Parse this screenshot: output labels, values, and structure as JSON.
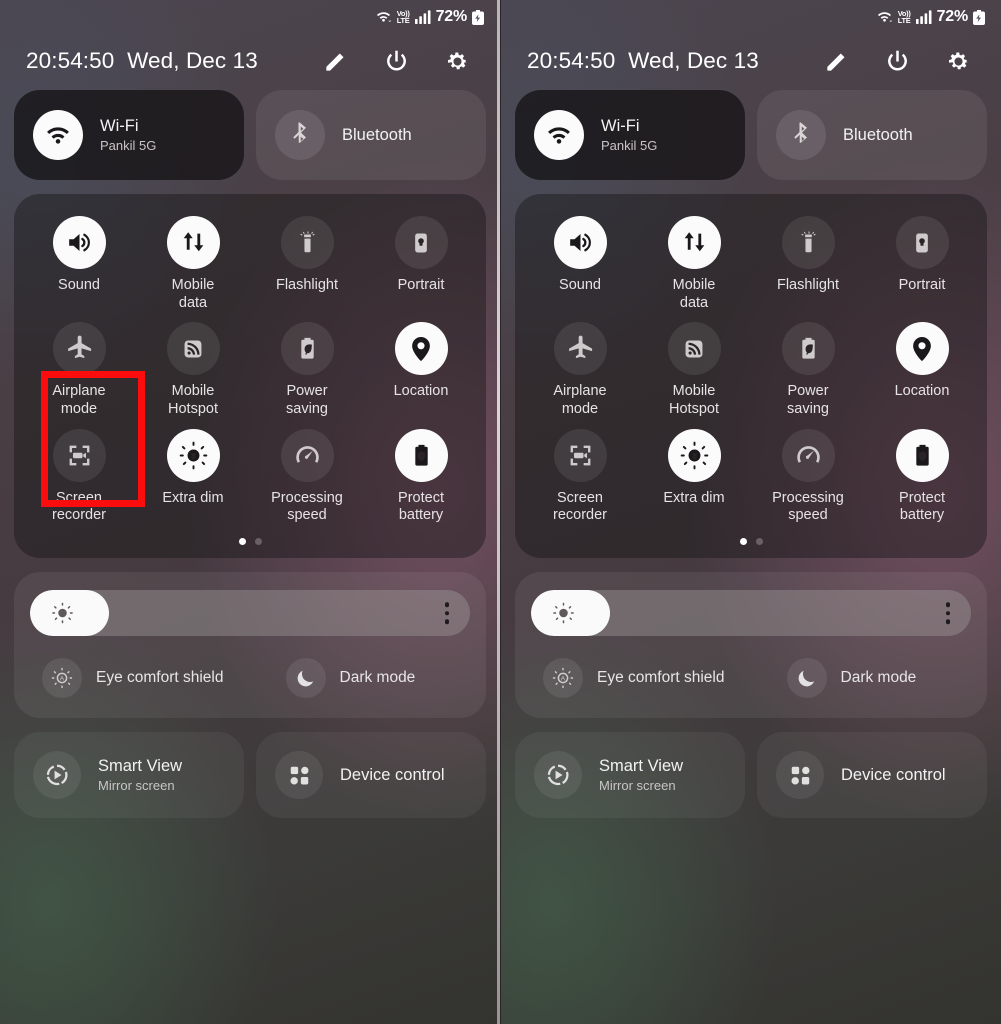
{
  "status_bar": {
    "wifi_icon": "wifi-icon",
    "volte_top": "Vo))",
    "volte_bottom": "LTE",
    "signal_icon": "signal-bars-icon",
    "battery_percent": "72%",
    "battery_icon": "battery-charging-icon"
  },
  "header": {
    "time": "20:54:50",
    "date": "Wed, Dec 13",
    "edit_icon": "pencil-icon",
    "power_icon": "power-icon",
    "settings_icon": "gear-icon"
  },
  "connectivity_tiles": [
    {
      "name": "wifi",
      "icon": "wifi-icon",
      "title": "Wi-Fi",
      "subtitle": "Pankil 5G",
      "active": true
    },
    {
      "name": "bluetooth",
      "icon": "bluetooth-icon",
      "title": "Bluetooth",
      "subtitle": "",
      "active": false
    }
  ],
  "quick_tiles": [
    {
      "name": "sound",
      "icon": "volume-icon",
      "label": "Sound",
      "active": true
    },
    {
      "name": "mobile-data",
      "icon": "data-transfer-icon",
      "label": "Mobile\ndata",
      "active": true
    },
    {
      "name": "flashlight",
      "icon": "flashlight-icon",
      "label": "Flashlight",
      "active": false
    },
    {
      "name": "portrait",
      "icon": "rotation-lock-icon",
      "label": "Portrait",
      "active": false
    },
    {
      "name": "airplane-mode",
      "icon": "airplane-icon",
      "label": "Airplane\nmode",
      "active": false
    },
    {
      "name": "mobile-hotspot",
      "icon": "hotspot-icon",
      "label": "Mobile\nHotspot",
      "active": false
    },
    {
      "name": "power-saving",
      "icon": "battery-leaf-icon",
      "label": "Power\nsaving",
      "active": false
    },
    {
      "name": "location",
      "icon": "location-pin-icon",
      "label": "Location",
      "active": true
    },
    {
      "name": "screen-recorder",
      "icon": "screen-record-icon",
      "label": "Screen\nrecorder",
      "active": false
    },
    {
      "name": "extra-dim",
      "icon": "extra-dim-icon",
      "label": "Extra dim",
      "active": true
    },
    {
      "name": "processing-speed",
      "icon": "speedometer-icon",
      "label": "Processing\nspeed",
      "active": false
    },
    {
      "name": "protect-battery",
      "icon": "battery-shield-icon",
      "label": "Protect\nbattery",
      "active": true
    }
  ],
  "page_indicator": {
    "total": 2,
    "current": 1
  },
  "brightness": {
    "level_percent": 18,
    "sun_icon": "brightness-sun-icon",
    "menu_icon": "three-dot-menu-icon"
  },
  "display_modes": [
    {
      "name": "eye-comfort-shield",
      "icon": "eye-comfort-icon",
      "label": "Eye comfort shield"
    },
    {
      "name": "dark-mode",
      "icon": "moon-icon",
      "label": "Dark mode"
    }
  ],
  "bottom_tiles": [
    {
      "name": "smart-view",
      "icon": "smart-view-icon",
      "title": "Smart View",
      "subtitle": "Mirror screen"
    },
    {
      "name": "device-control",
      "icon": "device-control-icon",
      "title": "Device control",
      "subtitle": ""
    }
  ],
  "annotations": [
    {
      "name": "highlight-airplane-mode",
      "target": "airplane-mode",
      "panel": "left",
      "color": "#fc0d0d"
    },
    {
      "name": "highlight-wifi",
      "target": "wifi",
      "panel": "right",
      "color": "#fc0d0d"
    }
  ]
}
